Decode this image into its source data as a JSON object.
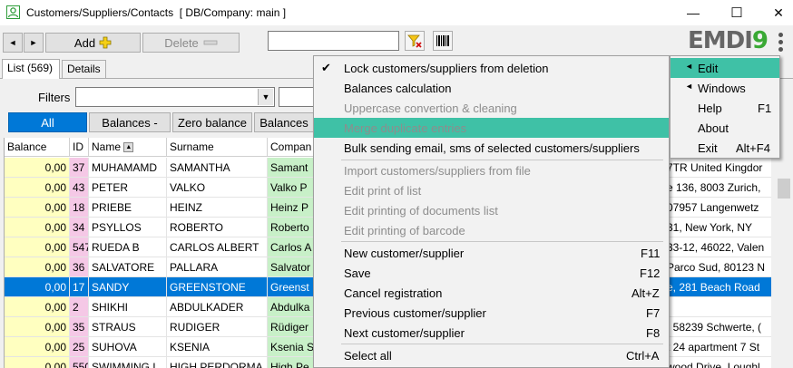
{
  "window": {
    "title": "Customers/Suppliers/Contacts",
    "db_info": "[ DB/Company: main ]",
    "minimize": "—",
    "maximize": "☐",
    "close": "✕"
  },
  "toolbar": {
    "prev": "◄",
    "next": "►",
    "add_label": "Add",
    "delete_label": "Delete",
    "search_value": "",
    "logo_main": "EMDI",
    "logo_nine": "9"
  },
  "tabs": [
    {
      "label": "List (569)"
    },
    {
      "label": "Details"
    }
  ],
  "filters": {
    "label": "Filters",
    "buttons": [
      "All",
      "Balances -",
      "Zero balance",
      "Balances"
    ]
  },
  "grid": {
    "columns": [
      "Balance",
      "ID",
      "Name",
      "Surname",
      "Compan"
    ],
    "rows": [
      {
        "balance": "0,00",
        "id": "37",
        "name": "MUHAMAMD",
        "surname": "SAMANTHA",
        "company": "Samant",
        "addr": "7TR United Kingdor"
      },
      {
        "balance": "0,00",
        "id": "43",
        "name": "PETER",
        "surname": "VALKO",
        "company": "Valko P",
        "addr": "e 136, 8003 Zurich,"
      },
      {
        "balance": "0,00",
        "id": "18",
        "name": "PRIEBE",
        "surname": "HEINZ",
        "company": "Heinz P",
        "addr": "07957 Langenwetz"
      },
      {
        "balance": "0,00",
        "id": "34",
        "name": "PSYLLOS",
        "surname": "ROBERTO",
        "company": "Roberto",
        "addr": "31, New York, NY"
      },
      {
        "balance": "0,00",
        "id": "547",
        "name": "RUEDA B",
        "surname": "CARLOS ALBERT",
        "company": "Carlos A",
        "addr": "33-12, 46022, Valen"
      },
      {
        "balance": "0,00",
        "id": "36",
        "name": "SALVATORE",
        "surname": "PALLARA",
        "company": "Salvator",
        "addr": "Parco Sud, 80123 N"
      },
      {
        "balance": "0,00",
        "id": "17",
        "name": "SANDY",
        "surname": "GREENSTONE",
        "company": "Greenst",
        "addr": "e, 281 Beach Road"
      },
      {
        "balance": "0,00",
        "id": "2",
        "name": "SHIKHI",
        "surname": "ABDULKADER",
        "company": "Abdulka",
        "addr": ""
      },
      {
        "balance": "0,00",
        "id": "35",
        "name": "STRAUS",
        "surname": "RUDIGER",
        "company": "Rüdiger",
        "addr": ", 58239 Schwerte, ("
      },
      {
        "balance": "0,00",
        "id": "25",
        "name": "SUHOVA",
        "surname": "KSENIA",
        "company": "Ksenia S",
        "addr": "t 24 apartment 7 St"
      },
      {
        "balance": "0,00",
        "id": "550",
        "name": "SWIMMING L",
        "surname": "HIGH PERDORMA",
        "company": "High Pe",
        "addr": "wood Drive, Loughl"
      }
    ]
  },
  "context_menu": {
    "items": [
      {
        "label": "Lock customers/suppliers from deletion",
        "checked": true,
        "disabled": false,
        "shortcut": ""
      },
      {
        "label": "Balances calculation",
        "disabled": false,
        "shortcut": ""
      },
      {
        "label": "Uppercase convertion & cleaning",
        "disabled": true,
        "shortcut": ""
      },
      {
        "label": "Merge duplicate entries",
        "disabled": true,
        "shortcut": ""
      },
      {
        "label": "Bulk sending email, sms of selected customers/suppliers",
        "disabled": false,
        "shortcut": ""
      },
      {
        "label": "Import customers/suppliers from file",
        "disabled": true,
        "shortcut": ""
      },
      {
        "label": "Edit print of list",
        "disabled": true,
        "shortcut": ""
      },
      {
        "label": "Edit printing of documents list",
        "disabled": true,
        "shortcut": ""
      },
      {
        "label": "Edit printing of barcode",
        "disabled": true,
        "shortcut": ""
      },
      {
        "label": "New customer/supplier",
        "disabled": false,
        "shortcut": "F11"
      },
      {
        "label": "Save",
        "disabled": false,
        "shortcut": "F12"
      },
      {
        "label": "Cancel registration",
        "disabled": false,
        "shortcut": "Alt+Z"
      },
      {
        "label": "Previous customer/supplier",
        "disabled": false,
        "shortcut": "F7"
      },
      {
        "label": "Next customer/supplier",
        "disabled": false,
        "shortcut": "F8"
      },
      {
        "label": "Select all",
        "disabled": false,
        "shortcut": "Ctrl+A"
      }
    ]
  },
  "main_menu": {
    "items": [
      {
        "label": "Edit",
        "submenu": true,
        "shortcut": ""
      },
      {
        "label": "Windows",
        "submenu": true,
        "shortcut": ""
      },
      {
        "label": "Help",
        "submenu": false,
        "shortcut": "F1"
      },
      {
        "label": "About",
        "submenu": false,
        "shortcut": ""
      },
      {
        "label": "Exit",
        "submenu": false,
        "shortcut": "Alt+F4"
      }
    ]
  },
  "colors": {
    "selection": "#0078d7",
    "menu_highlight": "#3fc1a6",
    "balance_col": "#ffffc0",
    "id_col": "#f5c8e6",
    "company_col": "#c8f0c8",
    "logo_accent": "#3aa935"
  }
}
